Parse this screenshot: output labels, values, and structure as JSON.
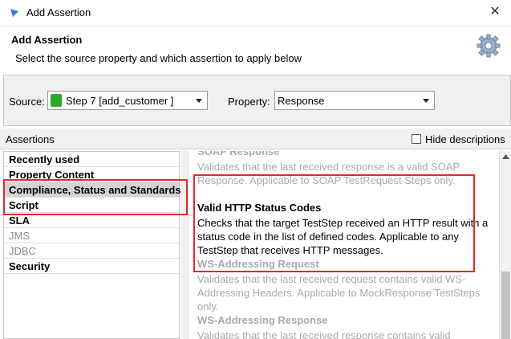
{
  "window": {
    "title": "Add Assertion"
  },
  "header": {
    "title": "Add Assertion",
    "description": "Select the source property and which assertion to apply below"
  },
  "source": {
    "label": "Source:",
    "value": "Step 7 [add_customer ]",
    "property_label": "Property:",
    "property_value": "Response"
  },
  "assertions_bar": {
    "label": "Assertions",
    "hide_descriptions_label": "Hide descriptions",
    "hide_descriptions_checked": false
  },
  "categories": [
    {
      "label": "Recently used",
      "disabled": false,
      "selected": false
    },
    {
      "label": "Property Content",
      "disabled": false,
      "selected": false
    },
    {
      "label": "Compliance, Status and Standards",
      "disabled": false,
      "selected": true
    },
    {
      "label": "Script",
      "disabled": false,
      "selected": false
    },
    {
      "label": "SLA",
      "disabled": false,
      "selected": false
    },
    {
      "label": "JMS",
      "disabled": true,
      "selected": false
    },
    {
      "label": "JDBC",
      "disabled": true,
      "selected": false
    },
    {
      "label": "Security",
      "disabled": false,
      "selected": false
    }
  ],
  "assertions": [
    {
      "title": "SOAP Response",
      "description": "Validates that the last received response is a valid SOAP Response. Applicable to SOAP TestRequest Steps only.",
      "enabled": false
    },
    {
      "title": "Valid HTTP Status Codes",
      "description": "Checks that the target TestStep received an HTTP result with a status code in the list of defined codes. Applicable to any TestStep that receives HTTP messages.",
      "enabled": true
    },
    {
      "title": "WS-Addressing Request",
      "description": "Validates that the last received request contains valid WS-Addressing Headers. Applicable to MockResponse TestSteps only.",
      "enabled": false
    },
    {
      "title": "WS-Addressing Response",
      "description": "Validates that the last received response contains valid",
      "enabled": false
    }
  ],
  "colors": {
    "highlight": "#e8242b",
    "selection": "#d4d4d4",
    "panel": "#f0f0f0"
  },
  "icons": [
    "app-icon",
    "close-icon",
    "gear-icon",
    "step-icon",
    "chevron-down-icon",
    "scroll-up-icon"
  ]
}
